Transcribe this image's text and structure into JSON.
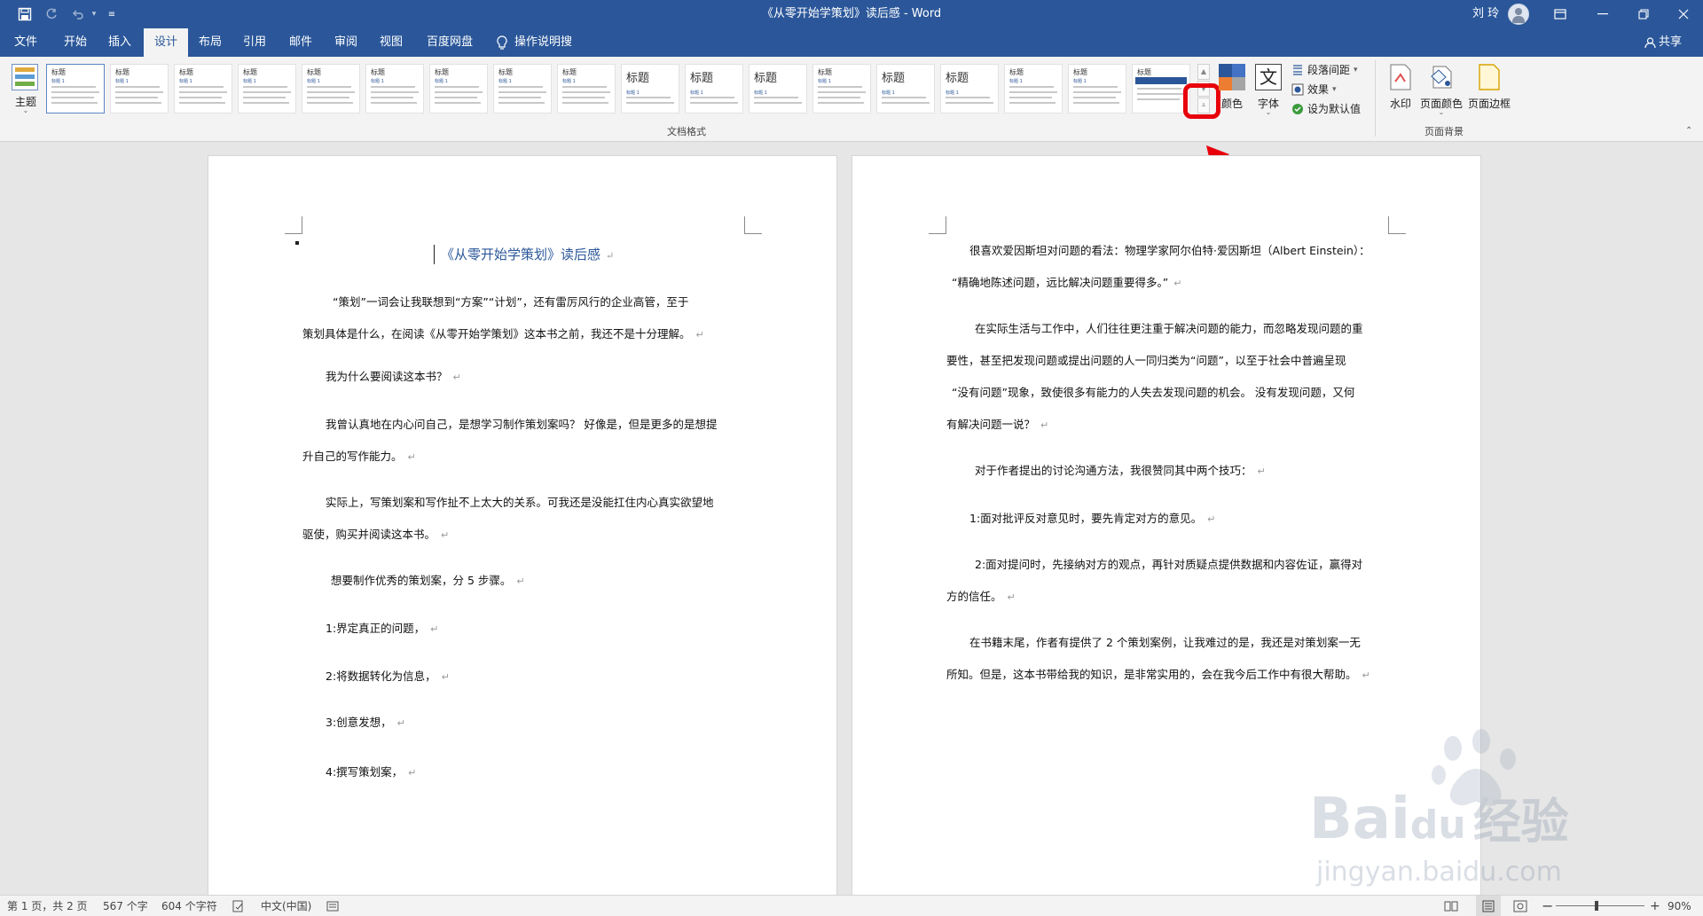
{
  "window": {
    "title": "《从零开始学策划》读后感  -  Word",
    "user": "刘 玲"
  },
  "tabs": [
    {
      "label": "文件"
    },
    {
      "label": "开始"
    },
    {
      "label": "插入"
    },
    {
      "label": "设计"
    },
    {
      "label": "布局"
    },
    {
      "label": "引用"
    },
    {
      "label": "邮件"
    },
    {
      "label": "审阅"
    },
    {
      "label": "视图"
    },
    {
      "label": "百度网盘"
    }
  ],
  "tell_me": "操作说明搜索",
  "share": "共享",
  "ribbon": {
    "theme": "主题",
    "gallery_title_short": "标题",
    "gallery_title_big": "标题",
    "gallery_sub": "标题 1",
    "gallery_group": "文档格式",
    "colors": "颜色",
    "fonts": "字体",
    "paragraph_spacing": "段落间距",
    "effects": "效果",
    "set_default": "设为默认值",
    "watermark": "水印",
    "page_color": "页面颜色",
    "page_borders": "页面边框",
    "page_bg_group": "页面背景"
  },
  "doc": {
    "title": "《从零开始学策划》读后感",
    "left_paras": [
      "“策划”一词会让我联想到“方案”“计划”，还有雷厉风行的企业高管，至于",
      "策划具体是什么，在阅读《从零开始学策划》这本书之前，我还不是十分理解。",
      "我为什么要阅读这本书？",
      "我曾认真地在内心问自己，是想学习制作策划案吗？ 好像是，但是更多的是想提",
      "升自己的写作能力。",
      "实际上，写策划案和写作扯不上太大的关系。可我还是没能扛住内心真实欲望地",
      "驱使，购买并阅读这本书。",
      "想要制作优秀的策划案，分 5 步骤。",
      "1:界定真正的问题，",
      "2:将数据转化为信息，",
      "3:创意发想，",
      "4:撰写策划案，"
    ],
    "right_paras": [
      "很喜欢爱因斯坦对问题的看法：物理学家阿尔伯特·爱因斯坦（Albert Einstein）：",
      "“精确地陈述问题，远比解决问题重要得多。”",
      "在实际生活与工作中，人们往往更注重于解决问题的能力，而忽略发现问题的重",
      "要性，甚至把发现问题或提出问题的人一同归类为“问题”，以至于社会中普遍呈现",
      "“没有问题”现象，致使很多有能力的人失去发现问题的机会。 没有发现问题，又何",
      "有解决问题一说？",
      "对于作者提出的讨论沟通方法，我很赞同其中两个技巧：",
      "1:面对批评反对意见时，要先肯定对方的意见。",
      "2:面对提问时，先接纳对方的观点，再针对质疑点提供数据和内容佐证，赢得对",
      "方的信任。",
      "在书籍末尾，作者有提供了 2 个策划案例，让我难过的是，我还是对策划案一无",
      "所知。但是，这本书带给我的知识，是非常实用的，会在我今后工作中有很大帮助。"
    ]
  },
  "status": {
    "page": "第 1 页，共 2 页",
    "words": "567 个字",
    "chars": "604 个字符",
    "lang": "中文(中国)",
    "zoom": "90%"
  },
  "watermark": {
    "brand": "Bai",
    "brand_du": "du",
    "brand_cn": "经验",
    "url": "jingyan.baidu.com"
  },
  "colors": {
    "accent": "#2b579a",
    "highlight": "#e8000b"
  }
}
